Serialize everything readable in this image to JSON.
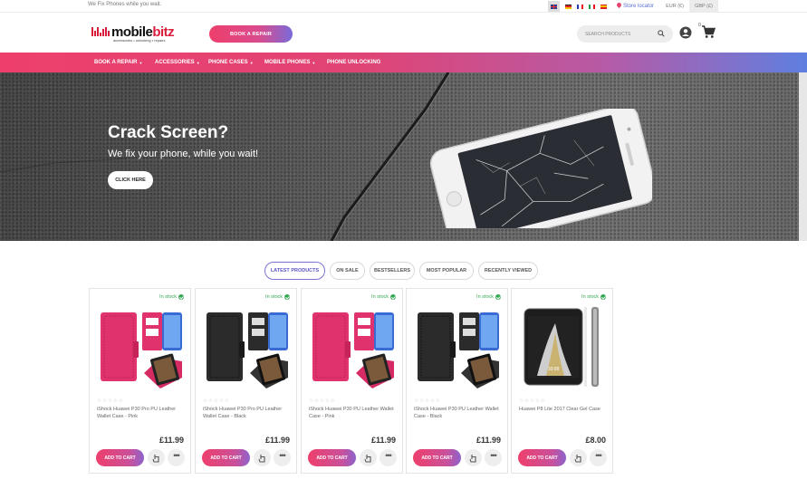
{
  "topbar": {
    "tagline": "We Fix Phones while you wait.",
    "languages": [
      "uk-flag-icon",
      "de-flag-icon",
      "fr-flag-icon",
      "it-flag-icon",
      "es-flag-icon"
    ],
    "store_locator": "Store locator",
    "currencies": [
      "EUR (€)",
      "GBP (£)"
    ]
  },
  "header": {
    "logo_main": "mobile",
    "logo_accent": "bitz",
    "logo_tagline": "accessories • unlocking • repairs",
    "repair_button": "BOOK A REPAIR",
    "search_placeholder": "SEARCH PRODUCTS",
    "cart_count": "0"
  },
  "nav": {
    "items": [
      "BOOK A REPAIR",
      "ACCESSORIES",
      "PHONE CASES",
      "MOBILE PHONES",
      "PHONE UNLOCKING"
    ]
  },
  "hero": {
    "title": "Crack Screen?",
    "subtitle": "We fix your phone, while you wait!",
    "cta": "CLICK HERE"
  },
  "tabs": [
    "LATEST PRODUCTS",
    "ON SALE",
    "BESTSELLERS",
    "MOST POPULAR",
    "RECENTLY VIEWED"
  ],
  "products": [
    {
      "stock": "In stock",
      "name": "iShock Huawei P30 Pro PU Leather Wallet Case - Pink",
      "price": "£11.99",
      "add_label": "ADD TO CART",
      "image": "pink-wallet-case",
      "stars": "☆☆☆☆☆"
    },
    {
      "stock": "In stock",
      "name": "iShock Huawei P30 Pro PU Leather Wallet Case - Black",
      "price": "£11.99",
      "add_label": "ADD TO CART",
      "image": "black-wallet-case",
      "stars": "☆☆☆☆☆"
    },
    {
      "stock": "In stock",
      "name": "iShock Huawei P30 PU Leather Wallet Case - Pink",
      "price": "£11.99",
      "add_label": "ADD TO CART",
      "image": "pink-wallet-case",
      "stars": "☆☆☆☆☆"
    },
    {
      "stock": "In stock",
      "name": "iShock Huawei P30 PU Leather Wallet Case - Black",
      "price": "£11.99",
      "add_label": "ADD TO CART",
      "image": "black-wallet-case",
      "stars": "☆☆☆☆☆"
    },
    {
      "stock": "In stock",
      "name": "Huawei P8 Lite 2017 Clear Gel Case",
      "price": "£8.00",
      "add_label": "ADD TO CART",
      "image": "clear-gel-case-phone",
      "stars": "☆☆☆☆☆"
    }
  ],
  "colors": {
    "accent_pink": "#ee3f6c",
    "accent_purple": "#7a6ad9",
    "brand_red": "#d81e3c",
    "stock_green": "#33a852"
  }
}
